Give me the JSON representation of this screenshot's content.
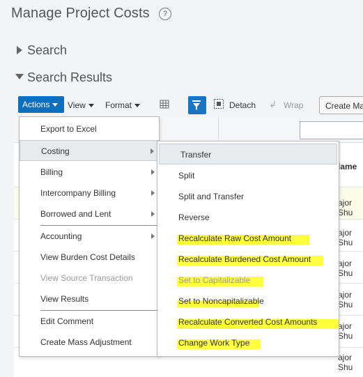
{
  "page": {
    "title": "Manage Project Costs",
    "help_icon": "?"
  },
  "sections": {
    "search": "Search",
    "search_results": "Search Results"
  },
  "toolbar": {
    "actions": "Actions",
    "view": "View",
    "format": "Format",
    "detach": "Detach",
    "wrap": "Wrap",
    "create": "Create Ma"
  },
  "table": {
    "header_partial": "lame",
    "row_partial": "ajor Shu"
  },
  "actions_menu": {
    "items": [
      {
        "label": "Export to Excel"
      },
      {
        "label": "Costing"
      },
      {
        "label": "Billing"
      },
      {
        "label": "Intercompany Billing"
      },
      {
        "label": "Borrowed and Lent"
      },
      {
        "label": "Accounting"
      },
      {
        "label": "View Burden Cost Details"
      },
      {
        "label": "View Source Transaction"
      },
      {
        "label": "View Results"
      },
      {
        "label": "Edit Comment"
      },
      {
        "label": "Create Mass Adjustment"
      }
    ]
  },
  "costing_submenu": {
    "items": [
      {
        "label": "Transfer"
      },
      {
        "label": "Split"
      },
      {
        "label": "Split and Transfer"
      },
      {
        "label": "Reverse"
      },
      {
        "label": "Recalculate Raw Cost Amount"
      },
      {
        "label": "Recalculate Burdened Cost Amount"
      },
      {
        "label": "Set to Capitalizable"
      },
      {
        "label": "Set to Noncapitalizable"
      },
      {
        "label": "Recalculate Converted Cost Amounts"
      },
      {
        "label": "Change Work Type"
      }
    ]
  },
  "colors": {
    "primary_button": "#0f6fbf",
    "highlight": "#ffff3d"
  }
}
